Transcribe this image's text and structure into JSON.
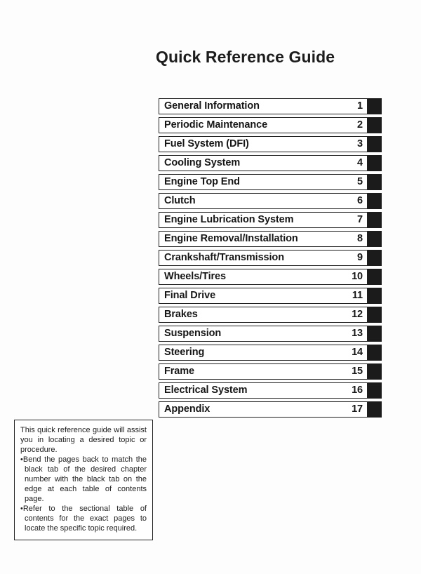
{
  "document": {
    "title": "Quick Reference Guide"
  },
  "chapters": [
    {
      "label": "General Information",
      "number": "1"
    },
    {
      "label": "Periodic Maintenance",
      "number": "2"
    },
    {
      "label": "Fuel System (DFI)",
      "number": "3"
    },
    {
      "label": "Cooling System",
      "number": "4"
    },
    {
      "label": "Engine Top End",
      "number": "5"
    },
    {
      "label": "Clutch",
      "number": "6"
    },
    {
      "label": "Engine Lubrication System",
      "number": "7"
    },
    {
      "label": "Engine Removal/Installation",
      "number": "8"
    },
    {
      "label": "Crankshaft/Transmission",
      "number": "9"
    },
    {
      "label": "Wheels/Tires",
      "number": "10"
    },
    {
      "label": "Final Drive",
      "number": "11"
    },
    {
      "label": "Brakes",
      "number": "12"
    },
    {
      "label": "Suspension",
      "number": "13"
    },
    {
      "label": "Steering",
      "number": "14"
    },
    {
      "label": "Frame",
      "number": "15"
    },
    {
      "label": "Electrical System",
      "number": "16"
    },
    {
      "label": "Appendix",
      "number": "17"
    }
  ],
  "note": {
    "intro": "This quick reference guide will assist you in locating a desired topic or procedure.",
    "bullet_glyph": "•",
    "items": [
      "Bend the pages back to match the black tab of the desired chapter number with the black tab on the edge at each table of contents page.",
      "Refer to the sectional table of contents for the exact pages to locate the specific topic required."
    ]
  },
  "colors": {
    "page_background": "#fdfdfd",
    "text": "#1a1a1a",
    "tab_black": "#1b1b1b",
    "box_border": "#1f1f1f"
  }
}
